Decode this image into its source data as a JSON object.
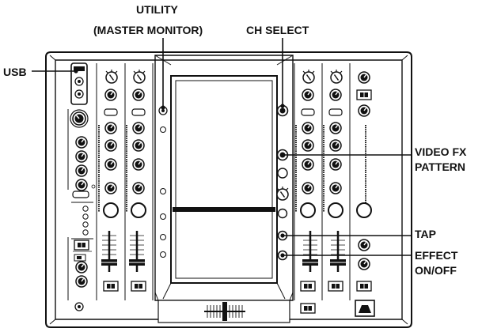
{
  "callouts": {
    "utility_line1": "UTILITY",
    "utility_line2": "(MASTER MONITOR)",
    "ch_select": "CH SELECT",
    "usb": "USB",
    "video_fx_line1": "VIDEO FX",
    "video_fx_line2": "PATTERN",
    "tap": "TAP",
    "effect_line1": "EFFECT",
    "effect_line2": "ON/OFF"
  },
  "colors": {
    "line": "#111111",
    "panel": "#ffffff",
    "screen_band": "#111111"
  }
}
